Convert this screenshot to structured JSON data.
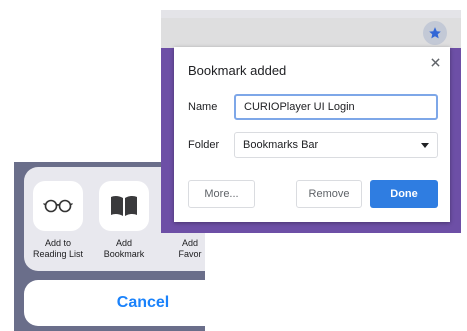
{
  "share_sheet": {
    "actions": [
      {
        "icon": "glasses-icon",
        "label": "Add to\nReading List"
      },
      {
        "icon": "book-icon",
        "label": "Add\nBookmark"
      },
      {
        "icon": "star-icon",
        "label": "Add\nFavor"
      }
    ],
    "cancel_label": "Cancel",
    "colors": {
      "accent": "#1a82fb",
      "backdrop": "#6a6e8a"
    }
  },
  "bookmark_dialog": {
    "title": "Bookmark added",
    "name_label": "Name",
    "name_value": "CURIOPlayer UI Login",
    "folder_label": "Folder",
    "folder_value": "Bookmarks Bar",
    "more_label": "More...",
    "remove_label": "Remove",
    "done_label": "Done",
    "colors": {
      "primary": "#2f7de1",
      "page_background": "#6d4fa6",
      "star": "#3367d6"
    }
  }
}
